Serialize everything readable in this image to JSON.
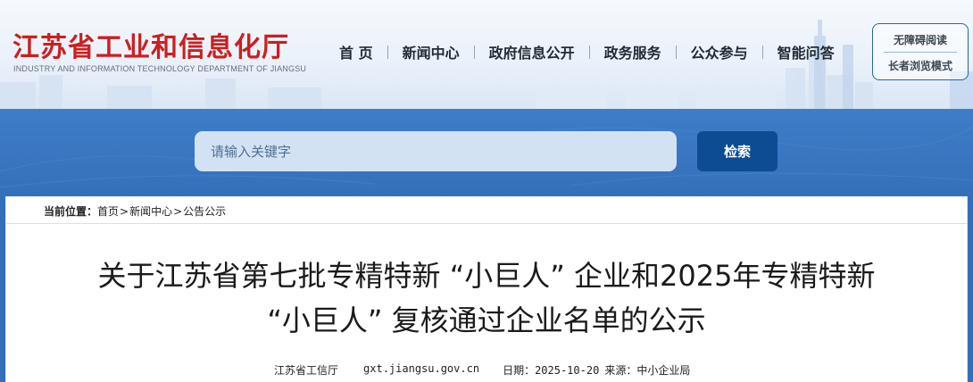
{
  "site": {
    "title": "江苏省工业和信息化厅",
    "subtitle": "INDUSTRY AND INFORMATION TECHNOLOGY DEPARTMENT OF JIANGSU"
  },
  "nav": {
    "items": [
      "首 页",
      "新闻中心",
      "政府信息公开",
      "政务服务",
      "公众参与",
      "智能问答"
    ]
  },
  "accessibility": {
    "items": [
      "无障碍阅读",
      "长者浏览模式"
    ]
  },
  "search": {
    "placeholder": "请输入关键字",
    "button_label": "检索"
  },
  "breadcrumb": {
    "label": "当前位置：",
    "items": [
      "首页",
      "新闻中心",
      "公告公示"
    ],
    "separator": ">"
  },
  "article": {
    "title_line1": "关于江苏省第七批专精特新 “小巨人” 企业和2025年专精特新",
    "title_line2": "“小巨人” 复核通过企业名单的公示",
    "source": "江苏省工信厅",
    "site": "gxt.jiangsu.gov.cn",
    "date": "日期：2025-10-20",
    "origin": "来源：中小企业局"
  },
  "colors": {
    "brand_red": "#cc1f1f",
    "search_band": "#3a76c1",
    "search_button": "#0d4c92"
  }
}
